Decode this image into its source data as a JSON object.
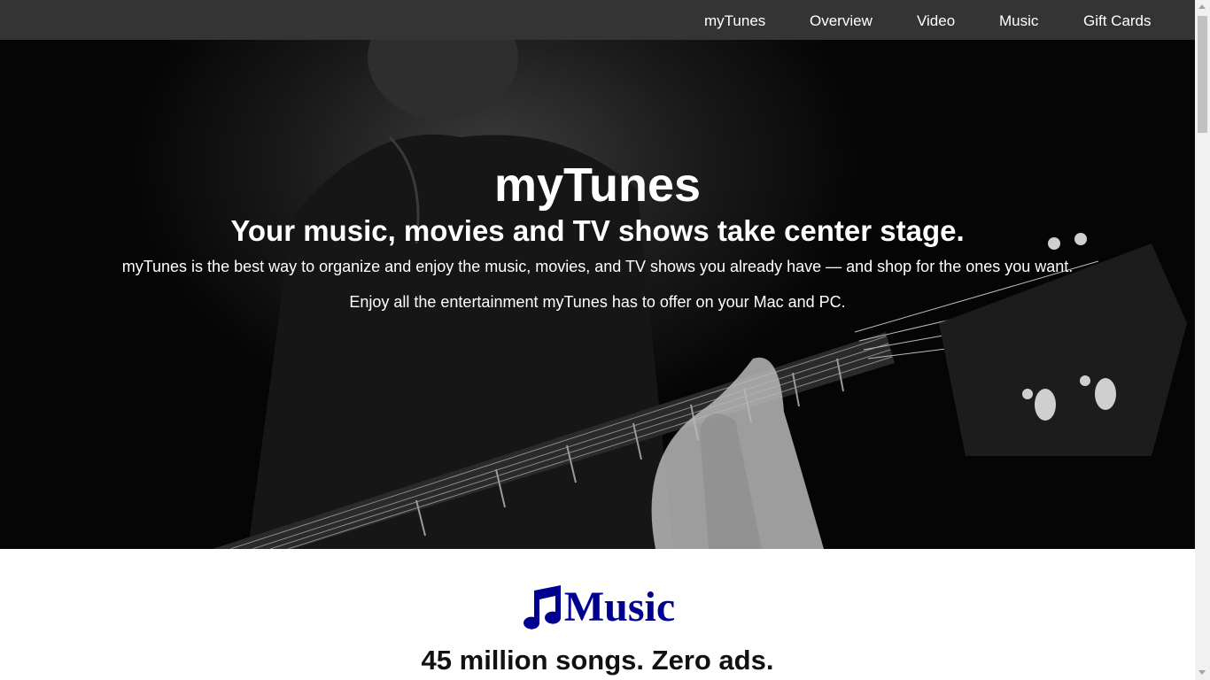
{
  "nav": {
    "items": [
      {
        "label": "myTunes"
      },
      {
        "label": "Overview"
      },
      {
        "label": "Video"
      },
      {
        "label": "Music"
      },
      {
        "label": "Gift Cards"
      }
    ]
  },
  "hero": {
    "title": "myTunes",
    "subtitle": "Your music, movies and TV shows take center stage.",
    "description": "myTunes is the best way to organize and enjoy the music, movies, and TV shows you already have — and shop for the ones you want.",
    "description2": "Enjoy all the entertainment myTunes has to offer on your Mac and PC."
  },
  "music_section": {
    "icon": "music-note-icon",
    "title": "Music",
    "tagline": "45 million songs. Zero ads."
  },
  "colors": {
    "nav_background": "#343434",
    "music_heading": "#000090",
    "hero_text": "#ffffff"
  }
}
